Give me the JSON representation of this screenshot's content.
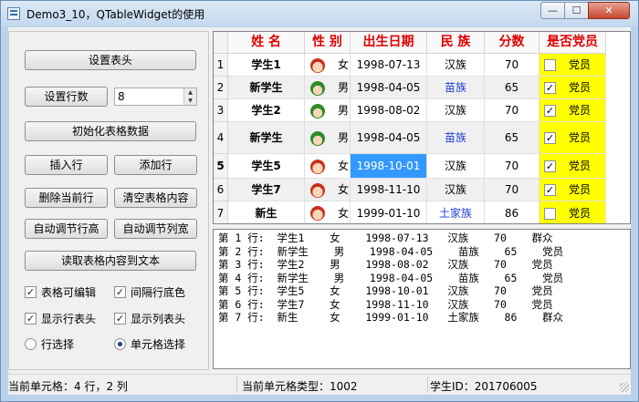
{
  "window": {
    "title": "Demo3_10，QTableWidget的使用",
    "min_glyph": "—",
    "max_glyph": "☐",
    "close_glyph": "✕"
  },
  "left_panel": {
    "buttons": {
      "set_header": "设置表头",
      "set_rows": "设置行数",
      "init_table": "初始化表格数据",
      "insert_row": "插入行",
      "append_row": "添加行",
      "delete_row": "删除当前行",
      "clear_table": "清空表格内容",
      "auto_row_height": "自动调节行高",
      "auto_col_width": "自动调节列宽",
      "read_to_text": "读取表格内容到文本"
    },
    "row_count": "8",
    "checkboxes": {
      "editable": {
        "label": "表格可编辑",
        "checked": true
      },
      "alternating": {
        "label": "间隔行底色",
        "checked": true
      },
      "show_row_header": {
        "label": "显示行表头",
        "checked": true
      },
      "show_col_header": {
        "label": "显示列表头",
        "checked": true
      }
    },
    "radios": {
      "row_select": {
        "label": "行选择",
        "selected": false
      },
      "cell_select": {
        "label": "单元格选择",
        "selected": true
      }
    }
  },
  "table": {
    "headers": [
      "姓 名",
      "性 别",
      "出生日期",
      "民 族",
      "分数",
      "是否党员"
    ],
    "rows": [
      {
        "num": "1",
        "name": "学生1",
        "gender": "女",
        "gender_icon": "female-avatar-icon",
        "birth": "1998-07-13",
        "nation": "汉族",
        "score": "70",
        "party": "党员",
        "party_checked": false
      },
      {
        "num": "2",
        "name": "新学生",
        "gender": "男",
        "gender_icon": "male-avatar-icon",
        "birth": "1998-04-05",
        "nation": "苗族",
        "score": "65",
        "party": "党员",
        "party_checked": true
      },
      {
        "num": "3",
        "name": "学生2",
        "gender": "男",
        "gender_icon": "male-avatar-icon",
        "birth": "1998-08-02",
        "nation": "汉族",
        "score": "70",
        "party": "党员",
        "party_checked": true
      },
      {
        "num": "4",
        "name": "新学生",
        "gender": "男",
        "gender_icon": "male-avatar-icon",
        "birth": "1998-04-05",
        "nation": "苗族",
        "score": "65",
        "party": "党员",
        "party_checked": true
      },
      {
        "num": "5",
        "name": "学生5",
        "gender": "女",
        "gender_icon": "female-avatar-icon",
        "birth": "1998-10-01",
        "nation": "汉族",
        "score": "70",
        "party": "党员",
        "party_checked": true
      },
      {
        "num": "6",
        "name": "学生7",
        "gender": "女",
        "gender_icon": "female-avatar-icon",
        "birth": "1998-11-10",
        "nation": "汉族",
        "score": "70",
        "party": "党员",
        "party_checked": true
      },
      {
        "num": "7",
        "name": "新生",
        "gender": "女",
        "gender_icon": "female-avatar-icon",
        "birth": "1999-01-10",
        "nation": "土家族",
        "score": "86",
        "party": "党员",
        "party_checked": false
      }
    ],
    "selected_cell": {
      "row": 5,
      "column": "出生日期"
    },
    "colors": {
      "header_text": "#e00000",
      "selection": "#3399ff",
      "party_cell": "#ffff00",
      "minority_text": "#1f3fd6"
    }
  },
  "text_output": {
    "lines": [
      "第 1 行:  学生1    女    1998-07-13   汉族    70    群众",
      "第 2 行:  新学生    男    1998-04-05    苗族    65    党员",
      "第 3 行:  学生2    男    1998-08-02   汉族    70    党员",
      "第 4 行:  新学生    男    1998-04-05    苗族    65    党员",
      "第 5 行:  学生5    女    1998-10-01   汉族    70    党员",
      "第 6 行:  学生7    女    1998-11-10   汉族    70    党员",
      "第 7 行:  新生     女    1999-01-10   土家族    86    群众"
    ]
  },
  "status_bar": {
    "current_cell": "当前单元格：4 行，2 列",
    "cell_type": "当前单元格类型：1002",
    "student_id": "学生ID：201706005"
  }
}
